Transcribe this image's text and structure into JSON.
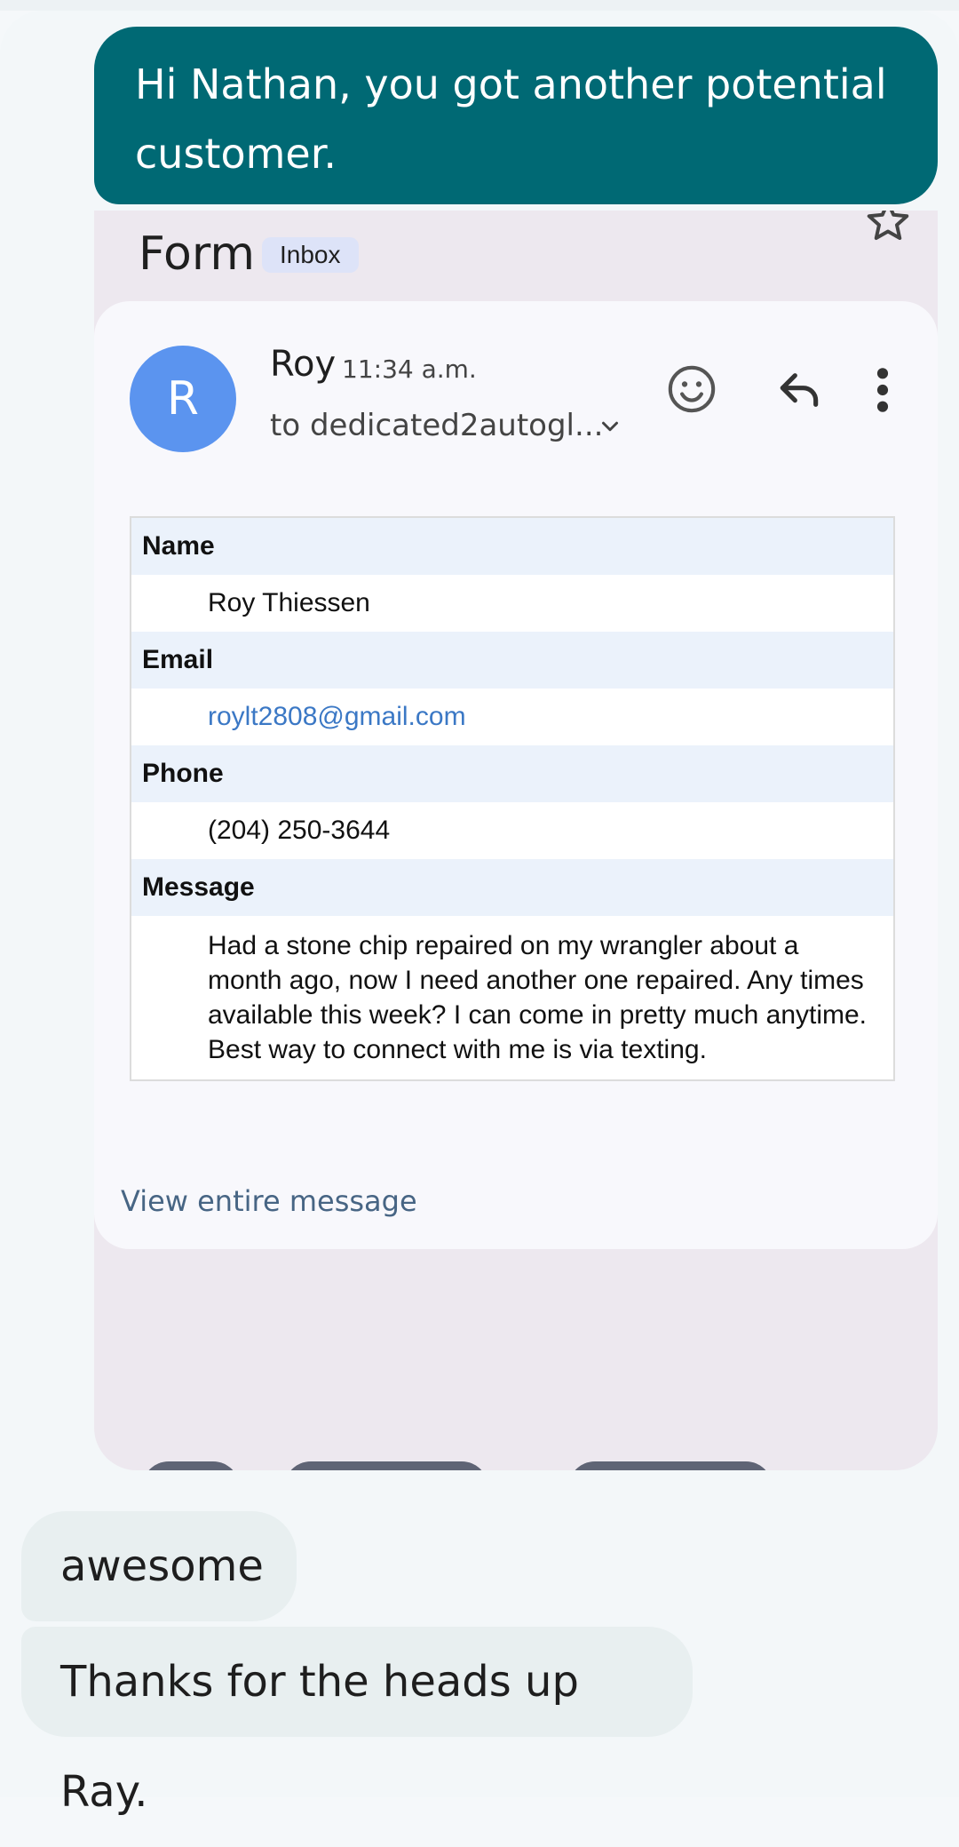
{
  "outgoing_message": "Hi Nathan, you got another potential customer.",
  "email": {
    "title": "Form",
    "label_chip": "Inbox",
    "avatar_letter": "R",
    "sender": "Roy",
    "time": "11:34 a.m.",
    "recipient": "to dedicated2autogl...",
    "fields": {
      "name_label": "Name",
      "name_value": "Roy Thiessen",
      "email_label": "Email",
      "email_value": "roylt2808@gmail.com",
      "phone_label": "Phone",
      "phone_value": "(204) 250-3644",
      "message_label": "Message",
      "message_value": "Had a stone chip repaired on my wrangler about a month ago, now I need another one repaired. Any times available this week? I can come in pretty much anytime. Best way to connect with me is via texting."
    },
    "view_entire": "View entire message",
    "icons": [
      "star-icon",
      "chevron-down-icon",
      "emoji-icon",
      "reply-icon",
      "more-vert-icon"
    ]
  },
  "incoming_messages": [
    {
      "text": "awesome"
    },
    {
      "text": "Thanks for the heads up Ray."
    }
  ],
  "colors": {
    "outgoing_bubble": "#006974",
    "incoming_bubble": "#e8eff0",
    "avatar": "#5b94ef",
    "link": "#3b78c5"
  }
}
